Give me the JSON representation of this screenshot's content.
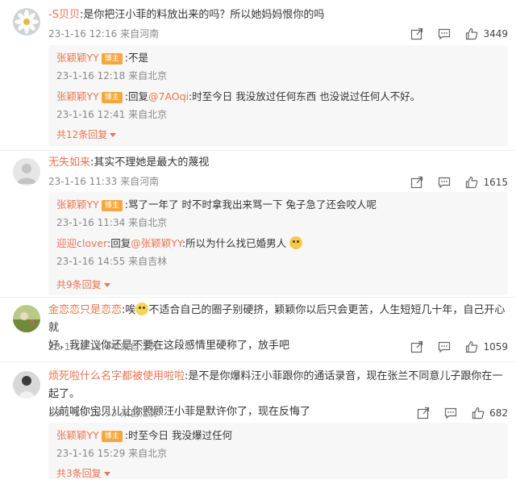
{
  "comments": [
    {
      "user": "-S贝贝",
      "text": ":是你把汪小菲的料放出来的吗？所以她妈妈恨你的吗",
      "time": "23-1-16 12:16",
      "loc": "来自河南",
      "likes": "3449",
      "replies": [
        {
          "user": "张颖颖YY",
          "badge": "博主",
          "prefix": "",
          "mention": "",
          "text": ":不是",
          "time": "23-1-16 12:18",
          "loc": "来自北京"
        },
        {
          "user": "张颖颖YY",
          "badge": "博主",
          "prefix": ":回复",
          "mention": "@7AOqi",
          "text": ":时至今日 我没放过任何东西 也没说过任何人不好。",
          "time": "23-1-16 12:41",
          "loc": "来自北京"
        }
      ],
      "more": "共12条回复"
    },
    {
      "user": "无失如来",
      "text": ":其实不理她是最大的蔑视",
      "time": "23-1-16 11:33",
      "loc": "来自河南",
      "likes": "1615",
      "replies": [
        {
          "user": "张颖颖YY",
          "badge": "博主",
          "prefix": "",
          "mention": "",
          "text": ":骂了一年了 时不时拿我出来骂一下 兔子急了还会咬人呢",
          "time": "23-1-16 11:34",
          "loc": "来自北京"
        },
        {
          "user": "迎迎clover",
          "badge": "",
          "prefix": ":回复",
          "mention": "@张颖颖YY",
          "text": ":所以为什么找已婚男人",
          "time": "23-1-16 14:55",
          "loc": "来自吉林"
        }
      ],
      "more": "共9条回复"
    },
    {
      "user": "金恋恋只是恋恋",
      "text_line1": ":唉",
      "text_line1b": "不适合自己的圈子别硬挤，颖颖你以后只会更苦，人生短短几十年，自己开心就",
      "text_line2": "好，我建议你还是不要在这段感情里硬称了，放手吧",
      "time": "23-1-16 12:44",
      "loc": "来自江苏",
      "likes": "1059"
    },
    {
      "user": "烦死啦什么名字都被使用啦啦",
      "text_line1": ":是不是你爆料汪小菲跟你的通话录音，现在张兰不同意儿子跟你在一起了。",
      "text_line2": "以前喊你宝贝儿让你照顾汪小菲是默许你了，现在反悔了",
      "time": "23-1-16 13:53",
      "loc": "来自江苏",
      "likes": "682",
      "replies": [
        {
          "user": "张颖颖YY",
          "badge": "博主",
          "prefix": "",
          "mention": "",
          "text": ":时至今日 我没爆过任何",
          "time": "23-1-16 15:29",
          "loc": "来自北京"
        }
      ],
      "more": "共3条回复"
    }
  ],
  "colors": {
    "accent": "#eb7350",
    "badge": "#f4a83a"
  },
  "icons": [
    "share-icon",
    "comment-icon",
    "like-icon"
  ]
}
